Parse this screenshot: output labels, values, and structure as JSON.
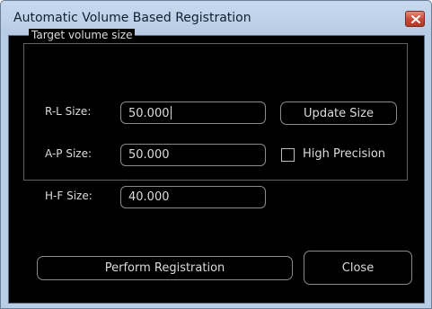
{
  "window": {
    "title": "Automatic Volume Based Registration"
  },
  "target_group": {
    "title": "Target volume size",
    "fields": [
      {
        "label": "R-L Size:",
        "value": "50.000"
      },
      {
        "label": "A-P Size:",
        "value": "50.000"
      },
      {
        "label": "H-F Size:",
        "value": "40.000"
      }
    ]
  },
  "buttons": {
    "update_size": "Update Size",
    "perform_registration": "Perform Registration",
    "close": "Close"
  },
  "high_precision": {
    "label": "High Precision",
    "checked": false
  },
  "icons": {
    "close": "close-icon"
  },
  "colors": {
    "dialog_background": "#000000",
    "text": "#dcdcdc",
    "frame": "#b8cde6",
    "close_button": "#c74734"
  }
}
